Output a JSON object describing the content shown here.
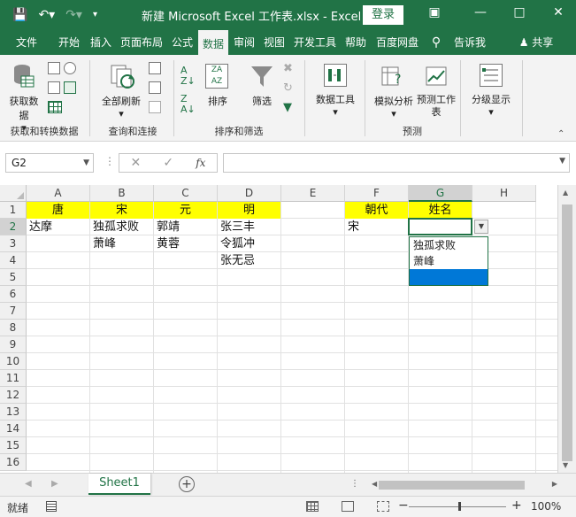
{
  "window": {
    "title": "新建 Microsoft Excel 工作表.xlsx  -  Excel",
    "login": "登录"
  },
  "tabs": [
    "文件",
    "开始",
    "插入",
    "页面布局",
    "公式",
    "数据",
    "审阅",
    "视图",
    "开发工具",
    "帮助",
    "百度网盘",
    "告诉我",
    "共享"
  ],
  "ribbon": {
    "get_data": "获取数据",
    "refresh_all": "全部刷新",
    "sort": "排序",
    "filter": "筛选",
    "data_tools": "数据工具",
    "what_if": "模拟分析",
    "forecast_sheet": "预测工作表",
    "outline": "分级显示",
    "groups": {
      "get_transform": "获取和转换数据",
      "queries": "查询和连接",
      "sort_filter": "排序和筛选",
      "forecast": "预测"
    }
  },
  "formula_bar": {
    "name_box": "G2",
    "fx": "fx",
    "value": ""
  },
  "columns": [
    "A",
    "B",
    "C",
    "D",
    "E",
    "F",
    "G",
    "H"
  ],
  "rows": [
    "1",
    "2",
    "3",
    "4",
    "5",
    "6",
    "7",
    "8",
    "9",
    "10",
    "11",
    "12",
    "13",
    "14",
    "15",
    "16"
  ],
  "cells": {
    "A1": "唐",
    "B1": "宋",
    "C1": "元",
    "D1": "明",
    "A2": "达摩",
    "B2": "独孤求败",
    "C2": "郭靖",
    "D2": "张三丰",
    "B3": "萧峰",
    "C3": "黄蓉",
    "D3": "令狐冲",
    "D4": "张无忌",
    "F1": "朝代",
    "G1": "姓名",
    "F2": "宋"
  },
  "dropdown": {
    "items": [
      "独孤求败",
      "萧峰",
      ""
    ],
    "highlighted_index": 2
  },
  "sheets": [
    "Sheet1"
  ],
  "status": {
    "ready": "就绪",
    "zoom": "100%"
  },
  "colors": {
    "excel_green": "#217346",
    "header_yellow": "#ffff00",
    "highlight_blue": "#0078d7"
  }
}
